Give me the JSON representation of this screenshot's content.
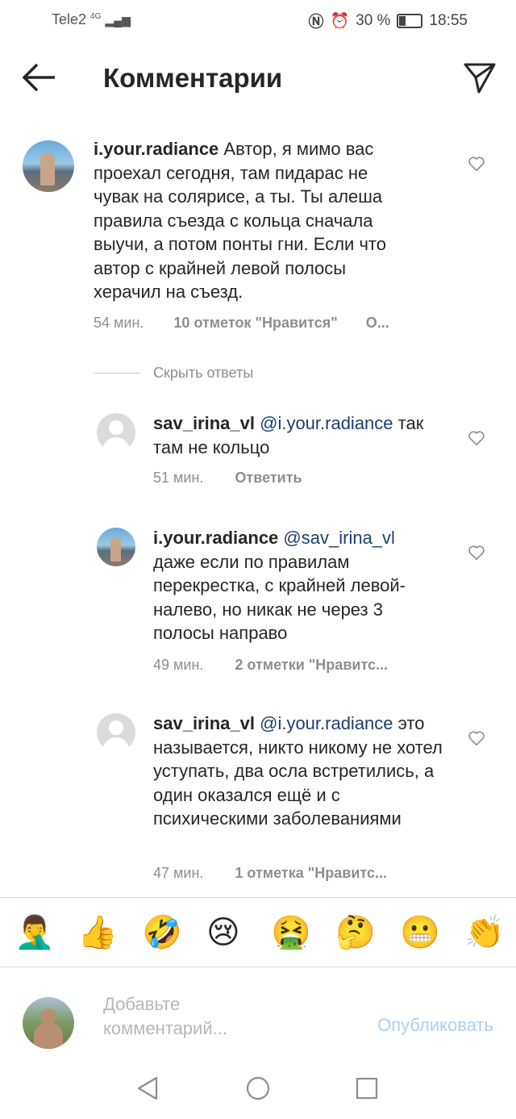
{
  "status_bar": {
    "carrier": "Tele2",
    "network": "4G",
    "battery": "30 %",
    "time": "18:55"
  },
  "header": {
    "title": "Комментарии"
  },
  "comments": [
    {
      "username": "i.your.radiance",
      "text": "Автор, я мимо вас проехал сегодня, там пидарас не чувак на солярисе, а ты. Ты алеша правила съезда с кольца сначала выучи, а потом понты гни. Если что автор с крайней левой полосы херачил на съезд.",
      "time": "54 мин.",
      "likes": "10 отметок \"Нравится\"",
      "action": "О..."
    }
  ],
  "hide_replies": "Скрыть ответы",
  "replies": [
    {
      "username": "sav_irina_vl",
      "mention": "@i.your.radiance",
      "text": "так там не кольцо",
      "time": "51 мин.",
      "action": "Ответить"
    },
    {
      "username": "i.your.radiance",
      "mention": "@sav_irina_vl",
      "text": "даже если по правилам перекрестка, с крайней левой-налево, но никак не через 3 полосы направо",
      "time": "49 мин.",
      "action": "2 отметки \"Нравитс..."
    },
    {
      "username": "sav_irina_vl",
      "mention": "@i.your.radiance",
      "text": "это называется, никто никому не хотел уступать, два осла встретились, а один оказался ещё и с психическими заболеваниями",
      "time": "47 мин.",
      "action": "1 отметка \"Нравитс..."
    }
  ],
  "emojis": [
    "🤦‍♂️",
    "👍",
    "🤣",
    "😢",
    "🤮",
    "🤔",
    "😬",
    "👏"
  ],
  "composer": {
    "placeholder": "Добавьте комментарий...",
    "publish": "Опубликовать"
  },
  "colors": {
    "mention": "#1c3f6e",
    "meta": "#8e8e8e",
    "publish_disabled": "#a8d1f5"
  }
}
